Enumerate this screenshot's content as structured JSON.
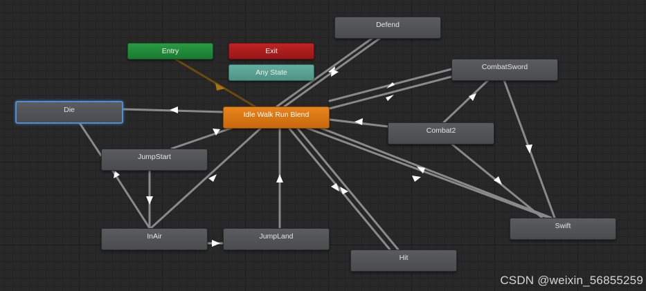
{
  "graph": {
    "nodes": {
      "entry": "Entry",
      "exit": "Exit",
      "any_state": "Any State",
      "idle_walk_run_blend": "Idle Walk Run Blend",
      "die": "Die",
      "defend": "Defend",
      "combat_sword": "CombatSword",
      "combat2": "Combat2",
      "jump_start": "JumpStart",
      "in_air": "InAir",
      "jump_land": "JumpLand",
      "hit": "Hit",
      "swift": "Swift"
    },
    "default_state": "Idle Walk Run Blend",
    "selected_state": "Die",
    "colors": {
      "entry": "#1f8a3a",
      "exit": "#ab1c1c",
      "any_state": "#5aa294",
      "default_state": "#d8761a",
      "state": "#515255",
      "selection": "#4c8fd6",
      "transition": "#8a8a8a",
      "canvas": "#282828"
    }
  },
  "watermark": "CSDN @weixin_56855259"
}
